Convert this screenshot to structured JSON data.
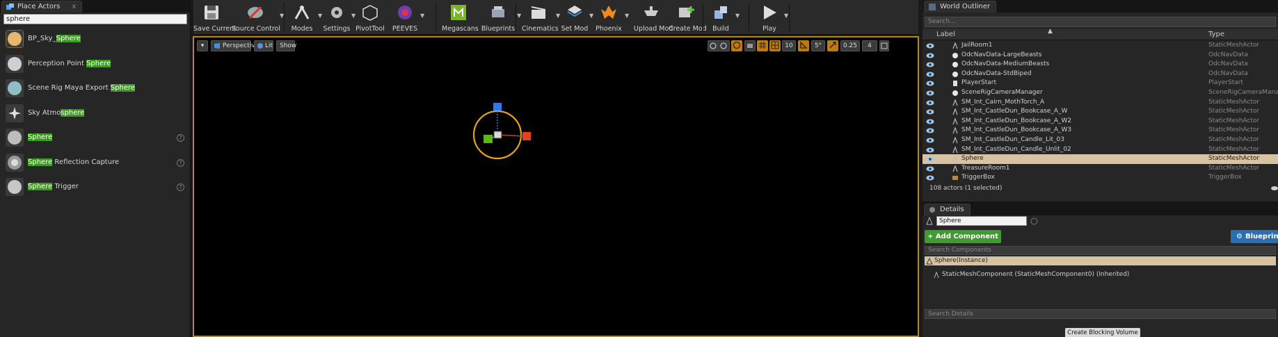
{
  "place_actors": {
    "tab_title": "Place Actors",
    "tab_close": "x",
    "search_value": "sphere",
    "items": [
      {
        "pre": "BP_Sky_",
        "match": "Sphere",
        "post": "",
        "help": false
      },
      {
        "pre": "Perception Point ",
        "match": "Sphere",
        "post": "",
        "help": false
      },
      {
        "pre": "Scene Rig Maya Export ",
        "match": "Sphere",
        "post": "",
        "help": false
      },
      {
        "pre": "Sky Atmo",
        "match": "sphere",
        "post": "",
        "help": false
      },
      {
        "pre": "",
        "match": "Sphere",
        "post": "",
        "help": true
      },
      {
        "pre": "",
        "match": "Sphere",
        "post": " Reflection Capture",
        "help": true
      },
      {
        "pre": "",
        "match": "Sphere",
        "post": " Trigger",
        "help": true
      }
    ],
    "help_glyph": "?"
  },
  "toolbar": {
    "buttons": [
      {
        "label": "Save Current",
        "icon": "save-icon"
      },
      {
        "label": "Source Control",
        "icon": "source-control-icon"
      },
      {
        "label": "Modes",
        "icon": "modes-icon"
      },
      {
        "label": "Settings",
        "icon": "settings-icon"
      },
      {
        "label": "PivotTool",
        "icon": "pivot-tool-icon"
      },
      {
        "label": "PEEVES",
        "icon": "peeves-icon"
      },
      {
        "label": "Megascans",
        "icon": "megascans-icon"
      },
      {
        "label": "Blueprints",
        "icon": "blueprints-icon"
      },
      {
        "label": "Cinematics",
        "icon": "cinematics-icon"
      },
      {
        "label": "Set Mod",
        "icon": "set-mod-icon"
      },
      {
        "label": "Phoenix",
        "icon": "phoenix-icon"
      },
      {
        "label": "Upload Mod",
        "icon": "upload-mod-icon"
      },
      {
        "label": "Create Mod",
        "icon": "create-mod-icon"
      },
      {
        "label": "Build",
        "icon": "build-icon"
      },
      {
        "label": "Play",
        "icon": "play-icon"
      }
    ],
    "dropdown_glyph": "▼"
  },
  "viewport": {
    "menu_glyph": "▾",
    "perspective_label": "Perspective",
    "lit_label": "Lit",
    "show_label": "Show",
    "grid_snap": "10",
    "rotation_snap": "5°",
    "scale_snap": "0.25",
    "layout_value": "4"
  },
  "outliner": {
    "tab_title": "World Outliner",
    "search_placeholder": "Search...",
    "col_label": "Label",
    "col_type": "Type",
    "rows": [
      {
        "label": "JailRoom1",
        "type": "StaticMeshActor",
        "icon": "static-mesh-icon",
        "selected": false
      },
      {
        "label": "OdcNavData-LargeBeasts",
        "type": "OdcNavData",
        "icon": "sphere-icon",
        "selected": false
      },
      {
        "label": "OdcNavData-MediumBeasts",
        "type": "OdcNavData",
        "icon": "sphere-icon",
        "selected": false
      },
      {
        "label": "OdcNavData-StdBiped",
        "type": "OdcNavData",
        "icon": "sphere-icon",
        "selected": false
      },
      {
        "label": "PlayerStart",
        "type": "PlayerStart",
        "icon": "player-start-icon",
        "selected": false
      },
      {
        "label": "SceneRigCameraManager",
        "type": "SceneRigCameraManage",
        "icon": "sphere-icon",
        "selected": false
      },
      {
        "label": "SM_Int_Cairn_MothTorch_A",
        "type": "StaticMeshActor",
        "icon": "static-mesh-icon",
        "selected": false
      },
      {
        "label": "SM_Int_CastleDun_Bookcase_A_W",
        "type": "StaticMeshActor",
        "icon": "static-mesh-icon",
        "selected": false
      },
      {
        "label": "SM_Int_CastleDun_Bookcase_A_W2",
        "type": "StaticMeshActor",
        "icon": "static-mesh-icon",
        "selected": false
      },
      {
        "label": "SM_Int_CastleDun_Bookcase_A_W3",
        "type": "StaticMeshActor",
        "icon": "static-mesh-icon",
        "selected": false
      },
      {
        "label": "SM_Int_CastleDun_Candle_Lit_03",
        "type": "StaticMeshActor",
        "icon": "static-mesh-icon",
        "selected": false
      },
      {
        "label": "SM_Int_CastleDun_Candle_Unlit_02",
        "type": "StaticMeshActor",
        "icon": "static-mesh-icon",
        "selected": false
      },
      {
        "label": "Sphere",
        "type": "StaticMeshActor",
        "icon": "static-mesh-icon",
        "selected": true
      },
      {
        "label": "TreasureRoom1",
        "type": "StaticMeshActor",
        "icon": "static-mesh-icon",
        "selected": false
      },
      {
        "label": "TriggerBox",
        "type": "TriggerBox",
        "icon": "trigger-box-icon",
        "selected": false
      }
    ],
    "status": "108 actors (1 selected)"
  },
  "details": {
    "tab_title": "Details",
    "name_value": "Sphere",
    "add_component_label": "+ Add Component ▾",
    "blueprint_label": "Blueprint",
    "search_components_placeholder": "Search Components",
    "instance_label": "Sphere(Instance)",
    "component_label": "StaticMeshComponent (StaticMeshComponent0) (Inherited)",
    "search_details_placeholder": "Search Details",
    "create_blocking_label": "Create Blocking Volume ▾"
  },
  "colors": {
    "search_highlight": "#3a9b1e",
    "selection": "#d7c3a2",
    "viewport_border": "#b08a2a",
    "add_component": "#3f9b2e",
    "blueprint": "#2a6fb4"
  }
}
